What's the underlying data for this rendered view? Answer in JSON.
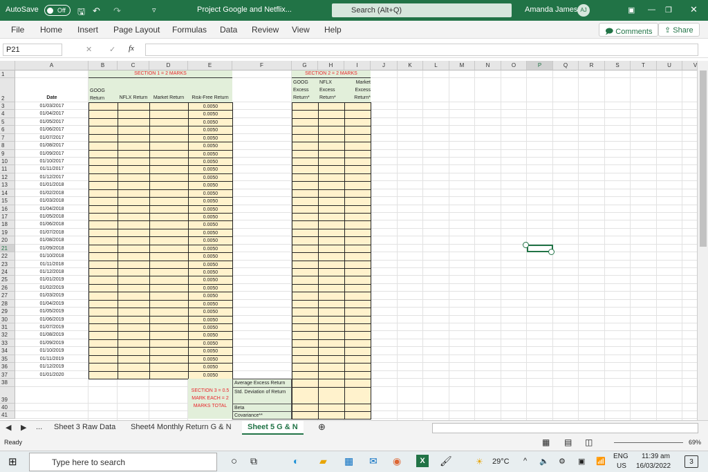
{
  "titlebar": {
    "autosave": "AutoSave",
    "toggle": "Off",
    "doc_title": "Project Google and Netflix...",
    "search_placeholder": "Search (Alt+Q)",
    "user": "Amanda James",
    "avatar": "AJ"
  },
  "menu": [
    "File",
    "Home",
    "Insert",
    "Page Layout",
    "Formulas",
    "Data",
    "Review",
    "View",
    "Help"
  ],
  "buttons": {
    "comments": "Comments",
    "share": "Share"
  },
  "formula_bar": {
    "name_box": "P21",
    "fx": "fx",
    "value": ""
  },
  "columns": [
    "A",
    "B",
    "C",
    "D",
    "E",
    "F",
    "G",
    "H",
    "I",
    "J",
    "K",
    "L",
    "M",
    "N",
    "O",
    "P",
    "Q",
    "R",
    "S",
    "T",
    "U",
    "V"
  ],
  "sheet": {
    "section1": "SECTION 1 = 2 MARKS",
    "section2": "SECTION 2 = 2 MARKS",
    "headers": {
      "date": "Date",
      "goog": "GOOG Return",
      "nflx": "NFLX Return",
      "market": "Market Return",
      "rf": "Risk-Free Return",
      "goog_ex": "GOOG Excess Return*",
      "nflx_ex": "NFLX Excess Return*",
      "mkt_ex": "Market Excess Return*"
    },
    "dates": [
      "01/03/2017",
      "01/04/2017",
      "01/05/2017",
      "01/06/2017",
      "01/07/2017",
      "01/08/2017",
      "01/09/2017",
      "01/10/2017",
      "01/11/2017",
      "01/12/2017",
      "01/01/2018",
      "01/02/2018",
      "01/03/2018",
      "01/04/2018",
      "01/05/2018",
      "01/06/2018",
      "01/07/2018",
      "01/08/2018",
      "01/09/2018",
      "01/10/2018",
      "01/11/2018",
      "01/12/2018",
      "01/01/2019",
      "01/02/2019",
      "01/03/2019",
      "01/04/2019",
      "01/05/2019",
      "01/06/2019",
      "01/07/2019",
      "01/08/2019",
      "01/09/2019",
      "01/10/2019",
      "01/11/2019",
      "01/12/2019",
      "01/01/2020"
    ],
    "risk_free": "0.0050",
    "section3": "SECTION 3 = 0.5 MARK EACH = 2 MARKS TOTAL",
    "stats": [
      "Average Excess Return",
      "Std. Deviation of Return",
      "Beta",
      "Covariance**"
    ]
  },
  "sheet_tabs": {
    "more": "...",
    "tabs": [
      "Sheet 3 Raw Data",
      "Sheet4 Monthly Return G & N",
      "Sheet 5 G & N"
    ],
    "active": 2
  },
  "status": {
    "ready": "Ready",
    "zoom": "69%"
  },
  "taskbar": {
    "search": "Type here to search",
    "weather": "29°C",
    "lang": "ENG",
    "region": "US",
    "time": "11:39 am",
    "date": "16/03/2022",
    "notifications": "3"
  },
  "colors": {
    "excel_green": "#217346",
    "header_fill": "#e2efda",
    "input_fill": "#fff2cc",
    "section_red": "#e8262b"
  }
}
